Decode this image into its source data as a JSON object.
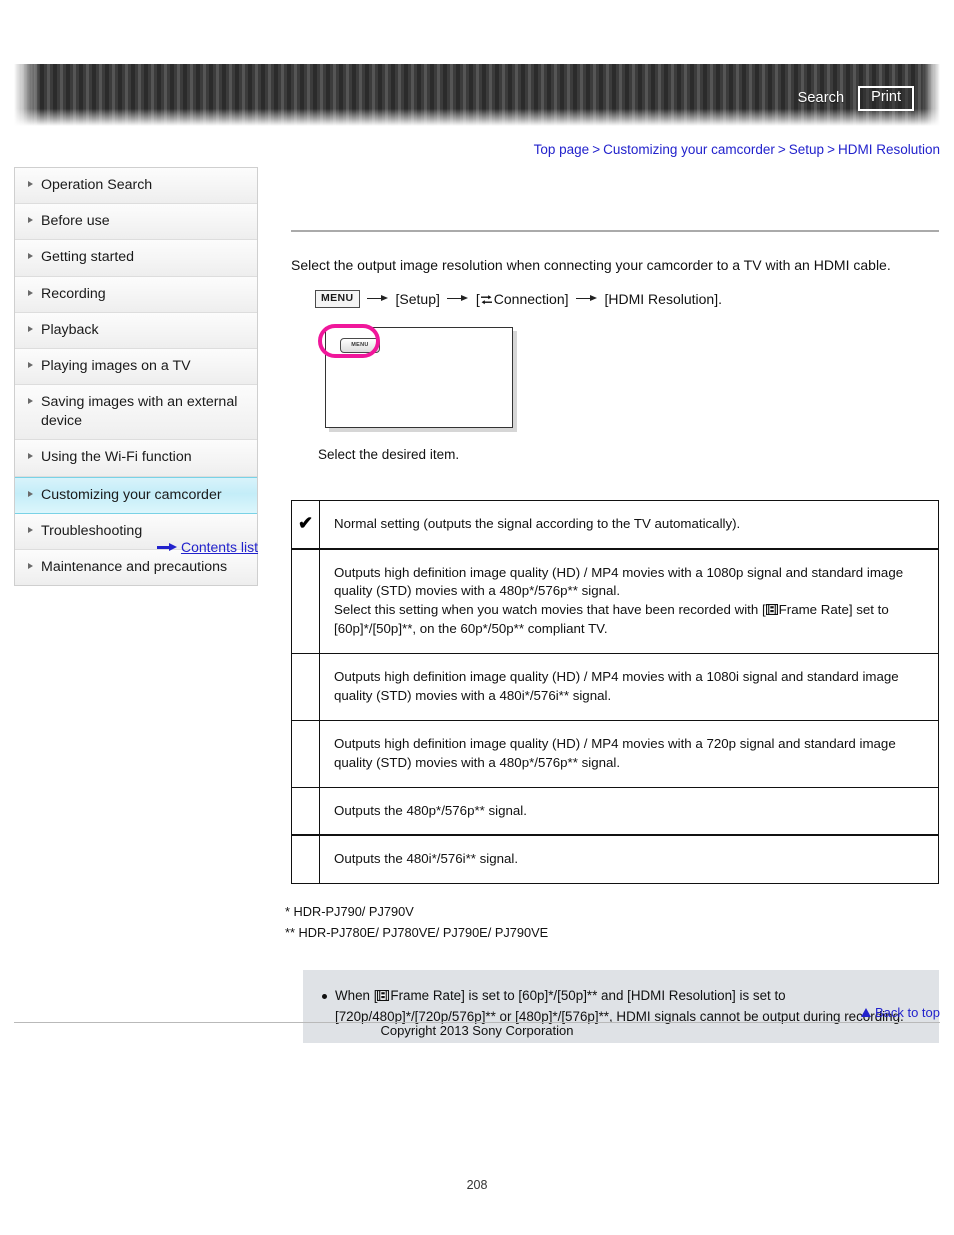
{
  "header": {
    "search_label": "Search",
    "print_label": "Print"
  },
  "breadcrumb": {
    "items": [
      "Top page",
      "Customizing your camcorder",
      "Setup",
      "HDMI Resolution"
    ],
    "separator": ">",
    "link_color": "#2222cc"
  },
  "sidebar": {
    "items": [
      {
        "label": "Operation Search",
        "active": false
      },
      {
        "label": "Before use",
        "active": false
      },
      {
        "label": "Getting started",
        "active": false
      },
      {
        "label": "Recording",
        "active": false
      },
      {
        "label": "Playback",
        "active": false
      },
      {
        "label": "Playing images on a TV",
        "active": false
      },
      {
        "label": "Saving images with an external device",
        "active": false
      },
      {
        "label": "Using the Wi-Fi function",
        "active": false
      },
      {
        "label": "Customizing your camcorder",
        "active": true
      },
      {
        "label": "Troubleshooting",
        "active": false
      },
      {
        "label": "Maintenance and precautions",
        "active": false
      }
    ],
    "contents_list_label": "Contents list",
    "active_color": "#c4edf8"
  },
  "main": {
    "intro": "Select the output image resolution when connecting your camcorder to a TV with an HDMI cable.",
    "menu_path": {
      "menu_chip": "MENU",
      "step_setup": "[Setup]",
      "step_connection_prefix": "[",
      "step_connection": "Connection]",
      "step_hdmi": "[HDMI Resolution]."
    },
    "illustration": {
      "menu_chip": "MENU",
      "highlight_color": "#f0179b"
    },
    "select_item_text": "Select the desired item.",
    "table": {
      "rows": [
        {
          "mark": "✔",
          "lines": [
            "Normal setting (outputs the signal according to the TV automatically)."
          ],
          "thick_bottom": true
        },
        {
          "mark": "",
          "lines": [
            "Outputs high definition image quality (HD) / MP4 movies with a 1080p signal and standard image quality (STD) movies with a 480p*/576p** signal.",
            "Select this setting when you watch movies that have been recorded with [{FILM}Frame Rate] set to [60p]*/[50p]**, on the 60p*/50p** compliant TV."
          ],
          "thick_bottom": false
        },
        {
          "mark": "",
          "lines": [
            "Outputs high definition image quality (HD) / MP4 movies with a 1080i signal and standard image quality (STD) movies with a 480i*/576i** signal."
          ],
          "thick_bottom": false
        },
        {
          "mark": "",
          "lines": [
            "Outputs high definition image quality (HD) / MP4 movies with a 720p signal and standard image quality (STD) movies with a 480p*/576p** signal."
          ],
          "thick_bottom": false
        },
        {
          "mark": "",
          "lines": [
            "Outputs the 480p*/576p** signal."
          ],
          "thick_bottom": true
        },
        {
          "mark": "",
          "lines": [
            "Outputs the 480i*/576i** signal."
          ],
          "thick_bottom": false
        }
      ]
    },
    "footnotes": [
      "* HDR-PJ790/ PJ790V",
      "** HDR-PJ780E/ PJ780VE/ PJ790E/ PJ790VE"
    ],
    "note": {
      "line1_prefix": "When [",
      "line1_rest": "Frame Rate] is set to [60p]*/[50p]** and [HDMI Resolution] is set to",
      "line2": "[720p/480p]*/[720p/576p]** or [480p]*/[576p]**, HDMI signals cannot be output during recording."
    }
  },
  "footer": {
    "back_to_top": "Back to top",
    "copyright": "Copyright 2013 Sony Corporation",
    "page_number": "208"
  }
}
